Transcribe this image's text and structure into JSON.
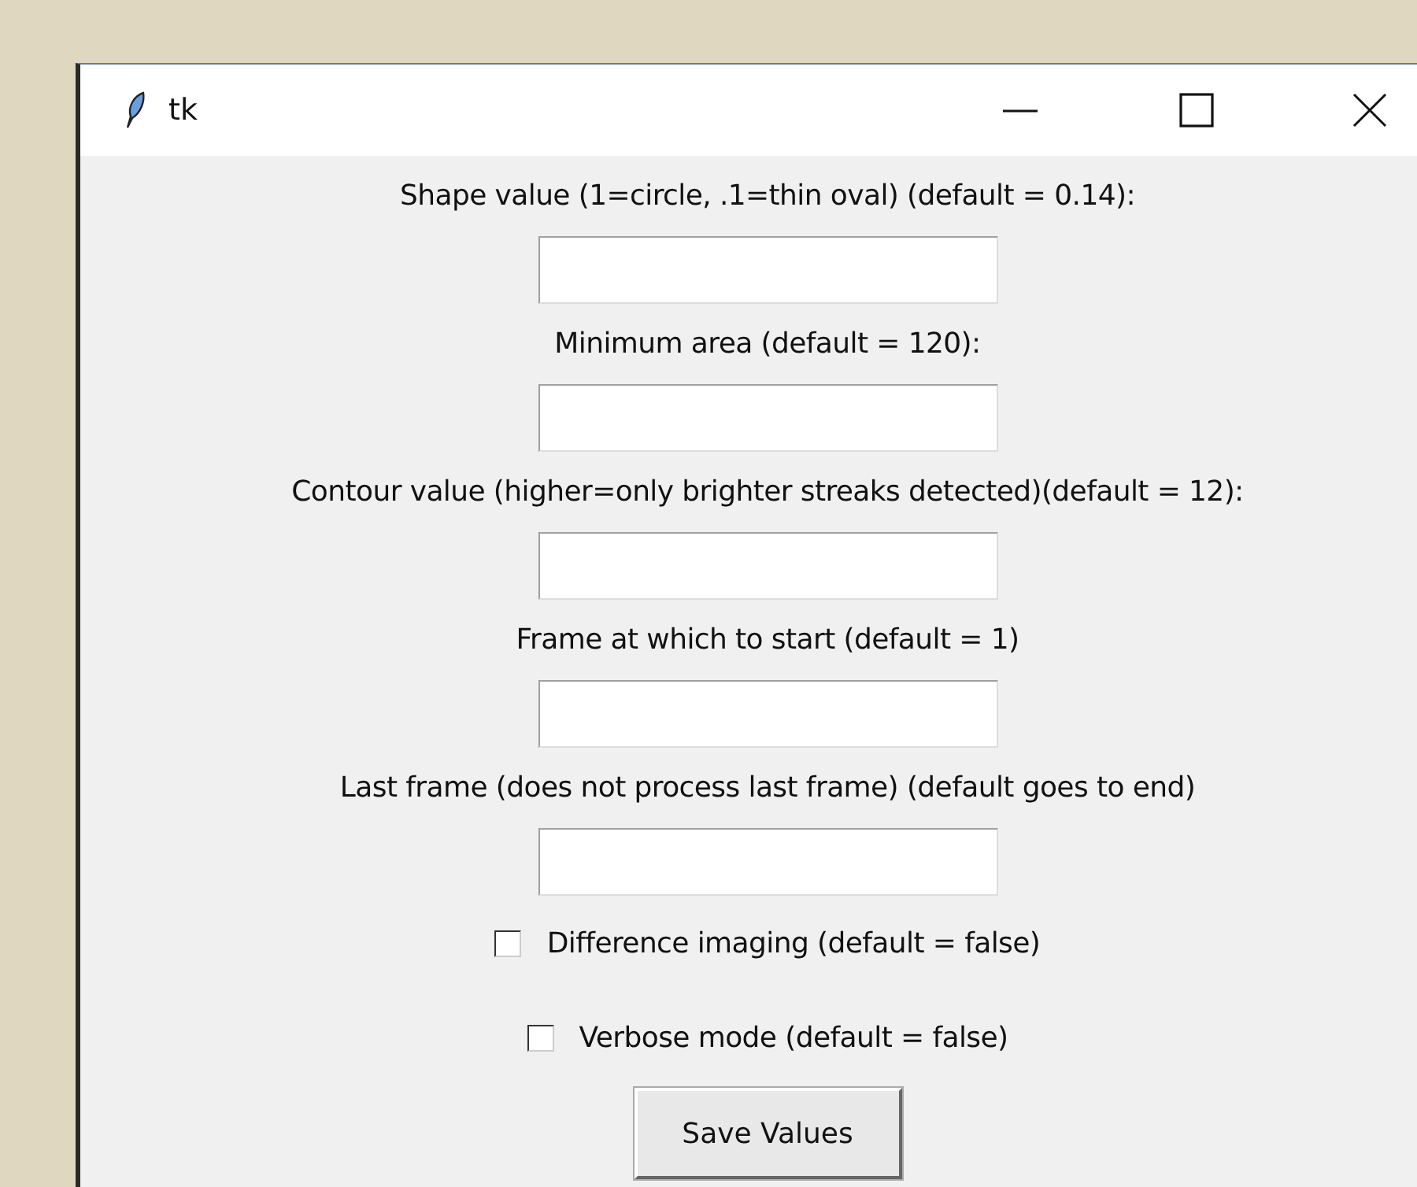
{
  "window": {
    "title": "tk"
  },
  "fields": [
    {
      "label": "Shape value (1=circle, .1=thin oval) (default = 0.14):"
    },
    {
      "label": "Minimum area (default = 120):"
    },
    {
      "label": "Contour value (higher=only brighter streaks detected)(default = 12):"
    },
    {
      "label": "Frame at which to start (default = 1)"
    },
    {
      "label": "Last frame (does not process last frame) (default goes to end)"
    }
  ],
  "checkboxes": [
    {
      "label": "Difference imaging (default = false)",
      "checked": false
    },
    {
      "label": "Verbose mode (default = false)",
      "checked": false
    }
  ],
  "buttons": [
    "Save Values"
  ]
}
